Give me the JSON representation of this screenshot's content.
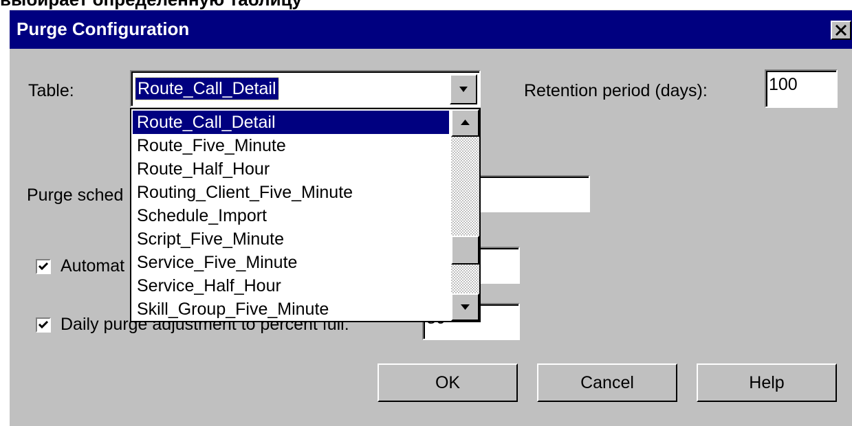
{
  "caption": "выбирает определенную таблицу",
  "dialog": {
    "title": "Purge Configuration",
    "close_glyph": "✕"
  },
  "table_field": {
    "label": "Table:",
    "value": "Route_Call_Detail",
    "options": [
      "Route_Call_Detail",
      "Route_Five_Minute",
      "Route_Half_Hour",
      "Routing_Client_Five_Minute",
      "Schedule_Import",
      "Script_Five_Minute",
      "Service_Five_Minute",
      "Service_Half_Hour",
      "Skill_Group_Five_Minute"
    ]
  },
  "retention": {
    "label": "Retention period (days):",
    "value": "100"
  },
  "purge_schedule": {
    "label": "Purge sched",
    "value": ""
  },
  "automatic": {
    "label": "Automat",
    "checked": true,
    "value": ""
  },
  "daily": {
    "label": "Daily purge adjustment to percent full:",
    "checked": true,
    "value": "80"
  },
  "buttons": {
    "ok": "OK",
    "cancel": "Cancel",
    "help": "Help"
  },
  "colors": {
    "title_bar": "#000080",
    "face": "#c0c0c0",
    "selection": "#000080"
  }
}
